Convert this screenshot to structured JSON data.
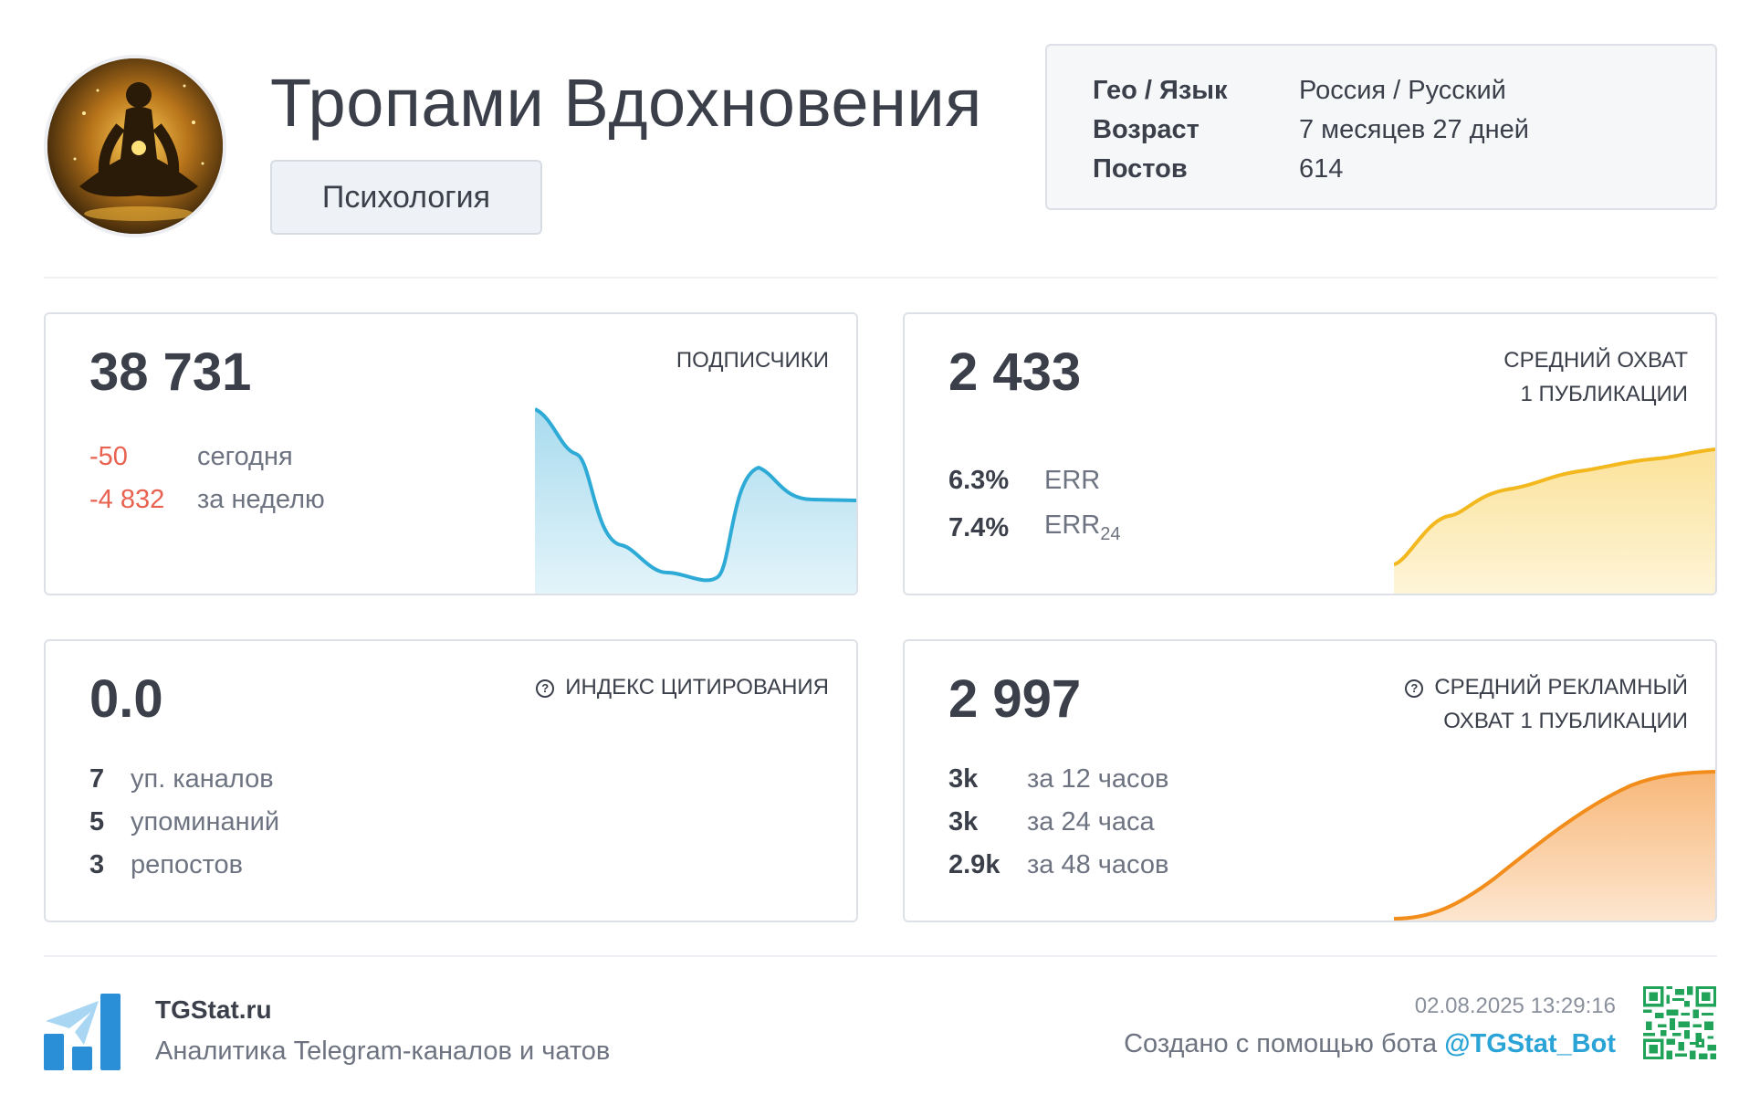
{
  "header": {
    "channel_title": "Тропами Вдохновения",
    "category": "Психология",
    "avatar_icon": "meditation-avatar-icon",
    "info": [
      {
        "label": "Гео / Язык",
        "value": "Россия / Русский"
      },
      {
        "label": "Возраст",
        "value": "7 месяцев 27 дней"
      },
      {
        "label": "Постов",
        "value": "614"
      }
    ]
  },
  "subscribers": {
    "value": "38 731",
    "label": "ПОДПИСЧИКИ",
    "today_value": "-50",
    "today_label": "сегодня",
    "week_value": "-4 832",
    "week_label": "за неделю",
    "color": "#2eaad6"
  },
  "avg_reach": {
    "value": "2 433",
    "label_line1": "СРЕДНИЙ ОХВАТ",
    "label_line2": "1 ПУБЛИКАЦИИ",
    "err_value": "6.3%",
    "err_label": "ERR",
    "err24_value": "7.4%",
    "err24_label": "ERR",
    "err24_sub": "24",
    "color": "#f2b81e"
  },
  "citation": {
    "value": "0.0",
    "label": "ИНДЕКС ЦИТИРОВАНИЯ",
    "help_icon": "question-circle-icon",
    "rows": [
      {
        "num": "7",
        "text": "уп. каналов"
      },
      {
        "num": "5",
        "text": "упоминаний"
      },
      {
        "num": "3",
        "text": "репостов"
      }
    ]
  },
  "ad_reach": {
    "value": "2 997",
    "label_line1": "СРЕДНИЙ РЕКЛАМНЫЙ",
    "label_line2": "ОХВАТ 1 ПУБЛИКАЦИИ",
    "help_icon": "question-circle-icon",
    "rows": [
      {
        "num": "3k",
        "text": "за 12 часов"
      },
      {
        "num": "3k",
        "text": "за 24 часа"
      },
      {
        "num": "2.9k",
        "text": "за 48 часов"
      }
    ],
    "color": "#f28c1a"
  },
  "footer": {
    "brand_name": "TGStat.ru",
    "tagline": "Аналитика Telegram-каналов и чатов",
    "timestamp": "02.08.2025 13:29:16",
    "created_by": "Создано с помощью бота",
    "bot_handle": "@TGStat_Bot",
    "logo_icon": "tgstat-logo-icon",
    "qr_icon": "qr-code-icon"
  }
}
